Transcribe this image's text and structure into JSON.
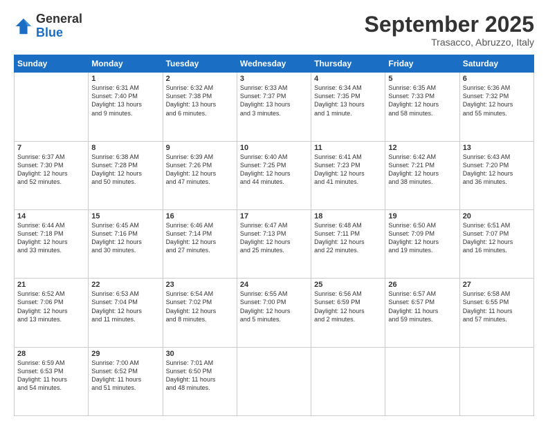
{
  "logo": {
    "general": "General",
    "blue": "Blue"
  },
  "header": {
    "month": "September 2025",
    "location": "Trasacco, Abruzzo, Italy"
  },
  "weekdays": [
    "Sunday",
    "Monday",
    "Tuesday",
    "Wednesday",
    "Thursday",
    "Friday",
    "Saturday"
  ],
  "weeks": [
    [
      {
        "day": "",
        "content": ""
      },
      {
        "day": "1",
        "content": "Sunrise: 6:31 AM\nSunset: 7:40 PM\nDaylight: 13 hours\nand 9 minutes."
      },
      {
        "day": "2",
        "content": "Sunrise: 6:32 AM\nSunset: 7:38 PM\nDaylight: 13 hours\nand 6 minutes."
      },
      {
        "day": "3",
        "content": "Sunrise: 6:33 AM\nSunset: 7:37 PM\nDaylight: 13 hours\nand 3 minutes."
      },
      {
        "day": "4",
        "content": "Sunrise: 6:34 AM\nSunset: 7:35 PM\nDaylight: 13 hours\nand 1 minute."
      },
      {
        "day": "5",
        "content": "Sunrise: 6:35 AM\nSunset: 7:33 PM\nDaylight: 12 hours\nand 58 minutes."
      },
      {
        "day": "6",
        "content": "Sunrise: 6:36 AM\nSunset: 7:32 PM\nDaylight: 12 hours\nand 55 minutes."
      }
    ],
    [
      {
        "day": "7",
        "content": "Sunrise: 6:37 AM\nSunset: 7:30 PM\nDaylight: 12 hours\nand 52 minutes."
      },
      {
        "day": "8",
        "content": "Sunrise: 6:38 AM\nSunset: 7:28 PM\nDaylight: 12 hours\nand 50 minutes."
      },
      {
        "day": "9",
        "content": "Sunrise: 6:39 AM\nSunset: 7:26 PM\nDaylight: 12 hours\nand 47 minutes."
      },
      {
        "day": "10",
        "content": "Sunrise: 6:40 AM\nSunset: 7:25 PM\nDaylight: 12 hours\nand 44 minutes."
      },
      {
        "day": "11",
        "content": "Sunrise: 6:41 AM\nSunset: 7:23 PM\nDaylight: 12 hours\nand 41 minutes."
      },
      {
        "day": "12",
        "content": "Sunrise: 6:42 AM\nSunset: 7:21 PM\nDaylight: 12 hours\nand 38 minutes."
      },
      {
        "day": "13",
        "content": "Sunrise: 6:43 AM\nSunset: 7:20 PM\nDaylight: 12 hours\nand 36 minutes."
      }
    ],
    [
      {
        "day": "14",
        "content": "Sunrise: 6:44 AM\nSunset: 7:18 PM\nDaylight: 12 hours\nand 33 minutes."
      },
      {
        "day": "15",
        "content": "Sunrise: 6:45 AM\nSunset: 7:16 PM\nDaylight: 12 hours\nand 30 minutes."
      },
      {
        "day": "16",
        "content": "Sunrise: 6:46 AM\nSunset: 7:14 PM\nDaylight: 12 hours\nand 27 minutes."
      },
      {
        "day": "17",
        "content": "Sunrise: 6:47 AM\nSunset: 7:13 PM\nDaylight: 12 hours\nand 25 minutes."
      },
      {
        "day": "18",
        "content": "Sunrise: 6:48 AM\nSunset: 7:11 PM\nDaylight: 12 hours\nand 22 minutes."
      },
      {
        "day": "19",
        "content": "Sunrise: 6:50 AM\nSunset: 7:09 PM\nDaylight: 12 hours\nand 19 minutes."
      },
      {
        "day": "20",
        "content": "Sunrise: 6:51 AM\nSunset: 7:07 PM\nDaylight: 12 hours\nand 16 minutes."
      }
    ],
    [
      {
        "day": "21",
        "content": "Sunrise: 6:52 AM\nSunset: 7:06 PM\nDaylight: 12 hours\nand 13 minutes."
      },
      {
        "day": "22",
        "content": "Sunrise: 6:53 AM\nSunset: 7:04 PM\nDaylight: 12 hours\nand 11 minutes."
      },
      {
        "day": "23",
        "content": "Sunrise: 6:54 AM\nSunset: 7:02 PM\nDaylight: 12 hours\nand 8 minutes."
      },
      {
        "day": "24",
        "content": "Sunrise: 6:55 AM\nSunset: 7:00 PM\nDaylight: 12 hours\nand 5 minutes."
      },
      {
        "day": "25",
        "content": "Sunrise: 6:56 AM\nSunset: 6:59 PM\nDaylight: 12 hours\nand 2 minutes."
      },
      {
        "day": "26",
        "content": "Sunrise: 6:57 AM\nSunset: 6:57 PM\nDaylight: 11 hours\nand 59 minutes."
      },
      {
        "day": "27",
        "content": "Sunrise: 6:58 AM\nSunset: 6:55 PM\nDaylight: 11 hours\nand 57 minutes."
      }
    ],
    [
      {
        "day": "28",
        "content": "Sunrise: 6:59 AM\nSunset: 6:53 PM\nDaylight: 11 hours\nand 54 minutes."
      },
      {
        "day": "29",
        "content": "Sunrise: 7:00 AM\nSunset: 6:52 PM\nDaylight: 11 hours\nand 51 minutes."
      },
      {
        "day": "30",
        "content": "Sunrise: 7:01 AM\nSunset: 6:50 PM\nDaylight: 11 hours\nand 48 minutes."
      },
      {
        "day": "",
        "content": ""
      },
      {
        "day": "",
        "content": ""
      },
      {
        "day": "",
        "content": ""
      },
      {
        "day": "",
        "content": ""
      }
    ]
  ]
}
